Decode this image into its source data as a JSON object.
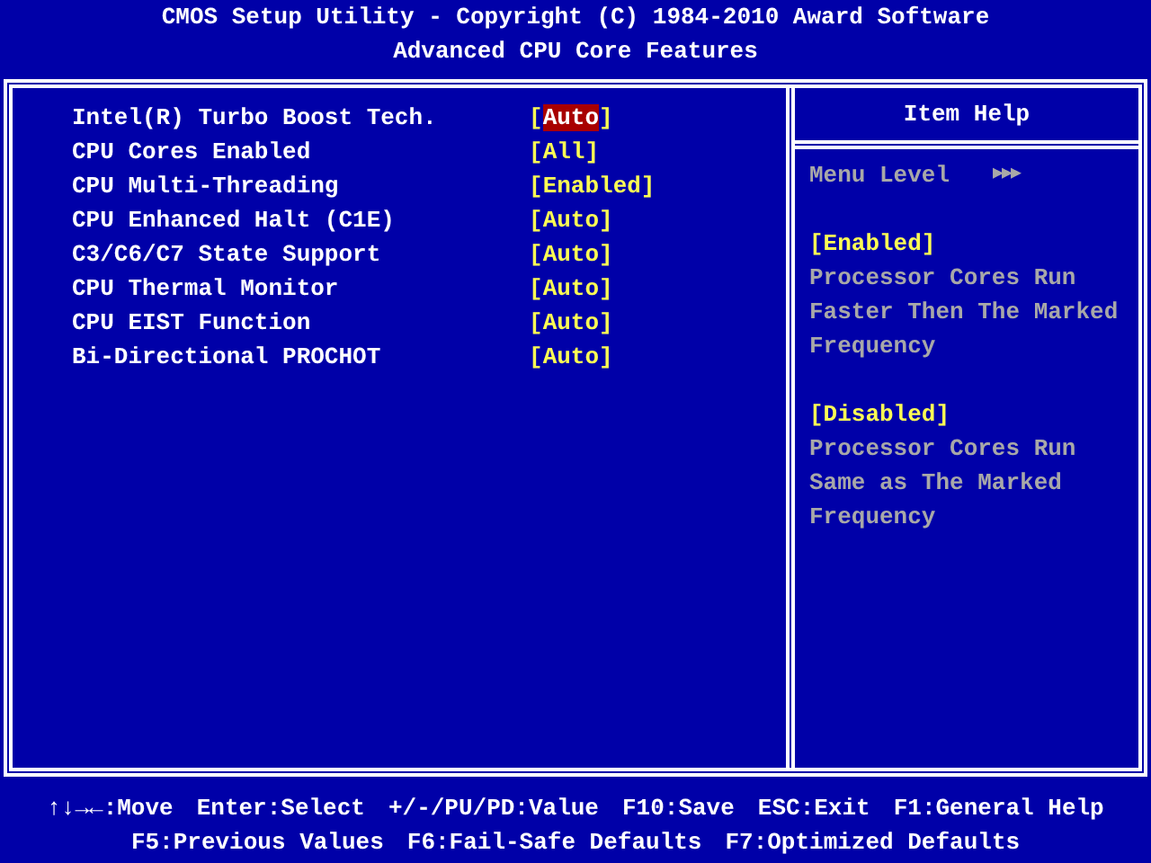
{
  "header": {
    "title": "CMOS Setup Utility - Copyright (C) 1984-2010 Award Software",
    "subtitle": "Advanced CPU Core Features"
  },
  "settings": [
    {
      "label": "Intel(R) Turbo Boost Tech.",
      "value": "[Auto]",
      "selected": true
    },
    {
      "label": "CPU Cores Enabled",
      "value": "[All]",
      "selected": false
    },
    {
      "label": "CPU Multi-Threading",
      "value": "[Enabled]",
      "selected": false
    },
    {
      "label": "CPU Enhanced Halt (C1E)",
      "value": "[Auto]",
      "selected": false
    },
    {
      "label": "C3/C6/C7 State Support",
      "value": "[Auto]",
      "selected": false
    },
    {
      "label": "CPU Thermal Monitor",
      "value": "[Auto]",
      "selected": false
    },
    {
      "label": "CPU EIST Function",
      "value": "[Auto]",
      "selected": false
    },
    {
      "label": "Bi-Directional PROCHOT",
      "value": "[Auto]",
      "selected": false
    }
  ],
  "item_help": {
    "title": "Item Help",
    "menu_level": {
      "label": "Menu Level",
      "marker": "▶▶▶"
    },
    "lines": [
      {
        "kind": "option",
        "text": "[Enabled]"
      },
      {
        "kind": "text",
        "text": "Processor Cores Run"
      },
      {
        "kind": "text",
        "text": "Faster Then The Marked"
      },
      {
        "kind": "text",
        "text": "Frequency"
      },
      {
        "kind": "blank"
      },
      {
        "kind": "option",
        "text": "[Disabled]"
      },
      {
        "kind": "text",
        "text": "Processor Cores Run"
      },
      {
        "kind": "text",
        "text": "Same as The Marked"
      },
      {
        "kind": "text",
        "text": "Frequency"
      }
    ]
  },
  "footer": [
    [
      "↑↓→←:Move",
      "Enter:Select",
      "+/-/PU/PD:Value",
      "F10:Save",
      "ESC:Exit",
      "F1:General Help"
    ],
    [
      "F5:Previous Values",
      "F6:Fail-Safe Defaults",
      "F7:Optimized Defaults"
    ]
  ]
}
